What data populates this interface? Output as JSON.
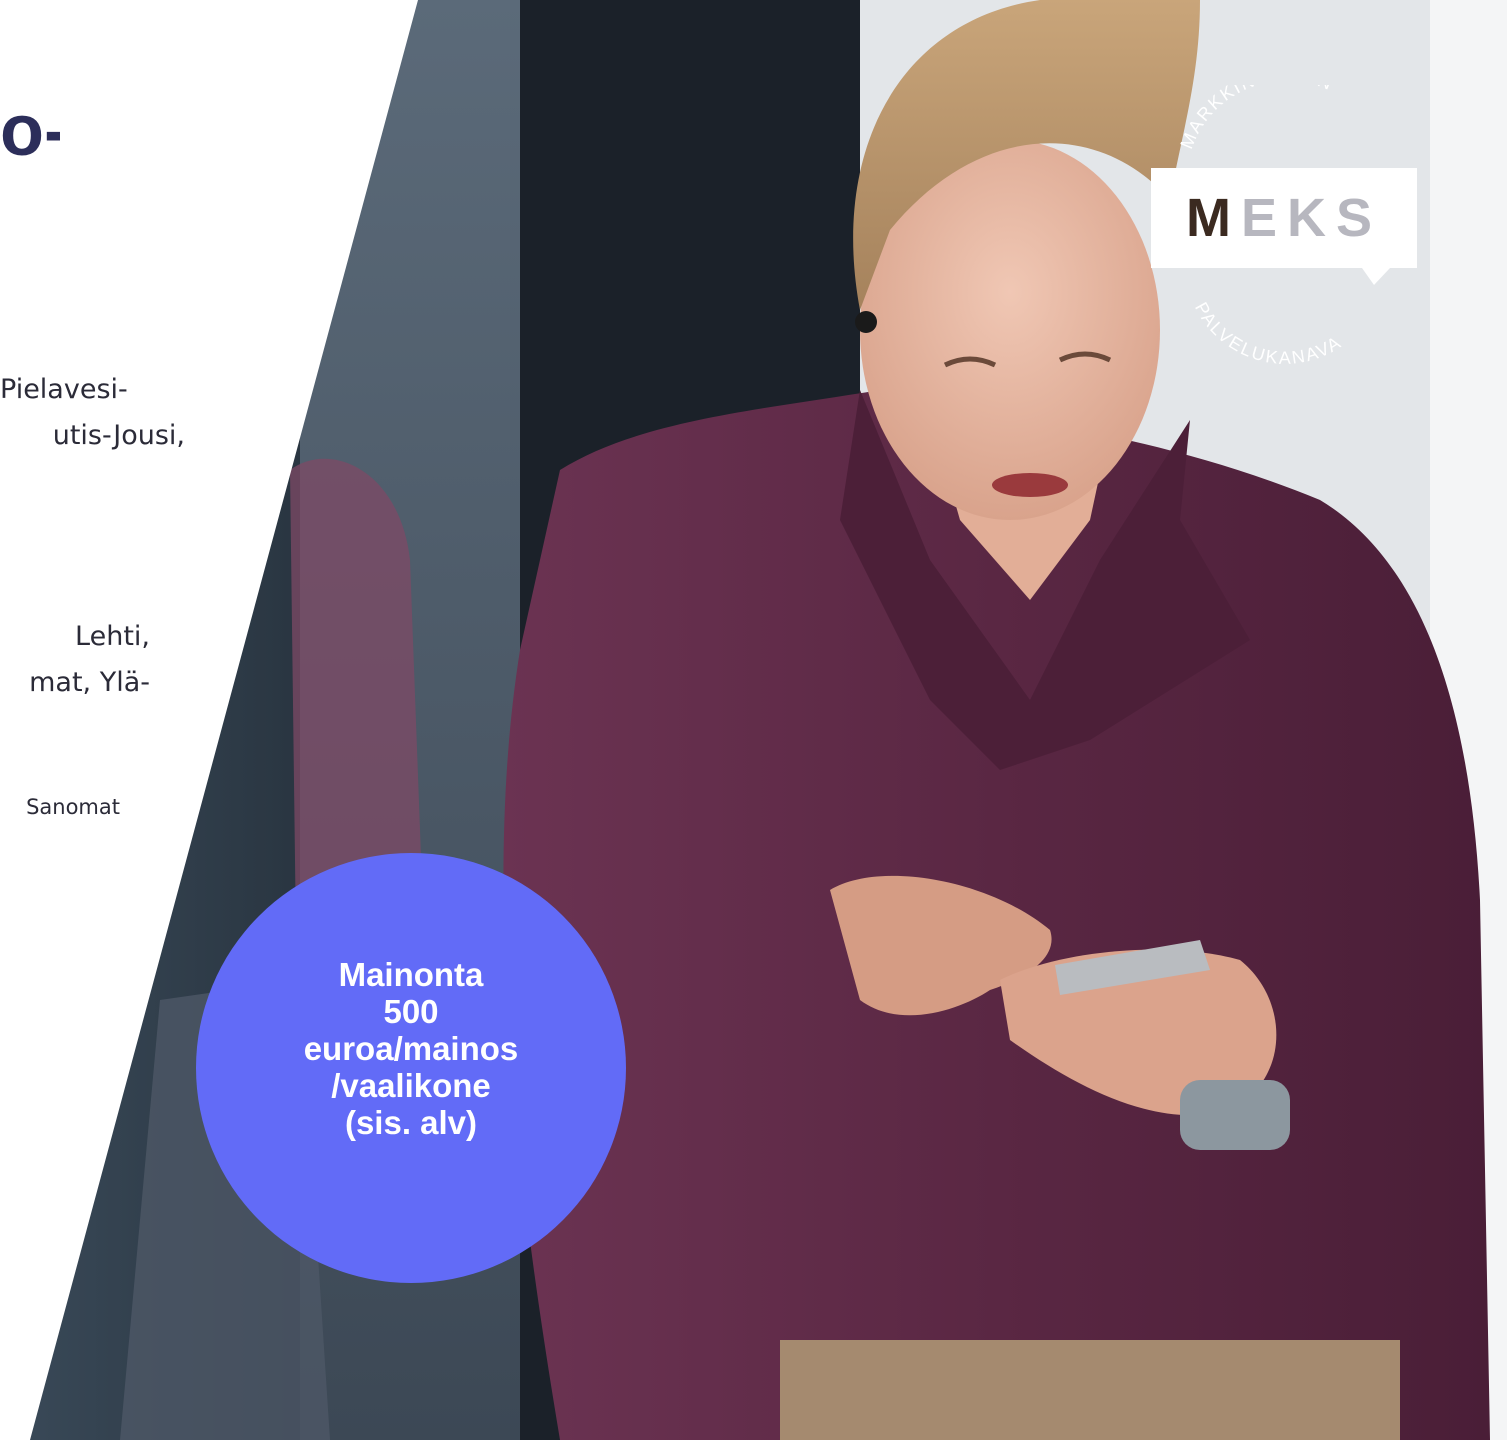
{
  "heading": {
    "fragment": "o-"
  },
  "paragraphs": {
    "first": [
      "Pielavesi-",
      "utis-Jousi,"
    ],
    "second": [
      "Lehti,",
      "mat, Ylä-"
    ],
    "third": "Sanomat"
  },
  "logo": {
    "arc_top": "MARKKINOINNIN",
    "wordmark": "MEKS",
    "arc_bottom": "PALVELUKANAVA"
  },
  "promo": {
    "lines": [
      "Mainonta",
      "500",
      "euroa/mainos",
      "/vaalikone",
      "(sis. alv)"
    ],
    "color": "#626bf7"
  },
  "colors": {
    "heading": "#2c2e5a",
    "shirt": "#5e2a45",
    "logo_gray": "#b7b7bf"
  }
}
